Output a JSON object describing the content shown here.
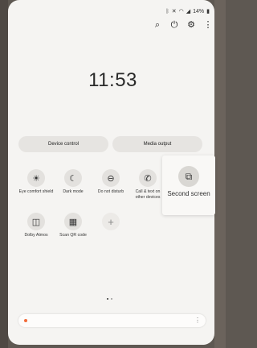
{
  "status_bar": {
    "icons": [
      "bluetooth-icon",
      "mute-icon",
      "wifi-icon",
      "signal-icon"
    ],
    "battery": "14%"
  },
  "top_icons": [
    "search-icon",
    "power-icon",
    "gear-icon",
    "more-icon"
  ],
  "clock": "11:53",
  "buttons": {
    "device_control": "Device control",
    "media_output": "Media output"
  },
  "tiles": [
    {
      "label": "Eye comfort shield",
      "icon": "eye-comfort-icon"
    },
    {
      "label": "Dark mode",
      "icon": "moon-icon"
    },
    {
      "label": "Do not disturb",
      "icon": "do-not-disturb-icon"
    },
    {
      "label": "Call & text on other devices",
      "icon": "call-text-icon"
    },
    {
      "label": "Dolby Atmos",
      "icon": "dolby-icon"
    },
    {
      "label": "Scan QR code",
      "icon": "qr-code-icon"
    },
    {
      "label": "",
      "icon": "plus-icon"
    }
  ],
  "second_screen": {
    "label": "Second screen",
    "icon": "second-screen-icon"
  },
  "page_indicator": {
    "pages": 2,
    "current": 1
  }
}
